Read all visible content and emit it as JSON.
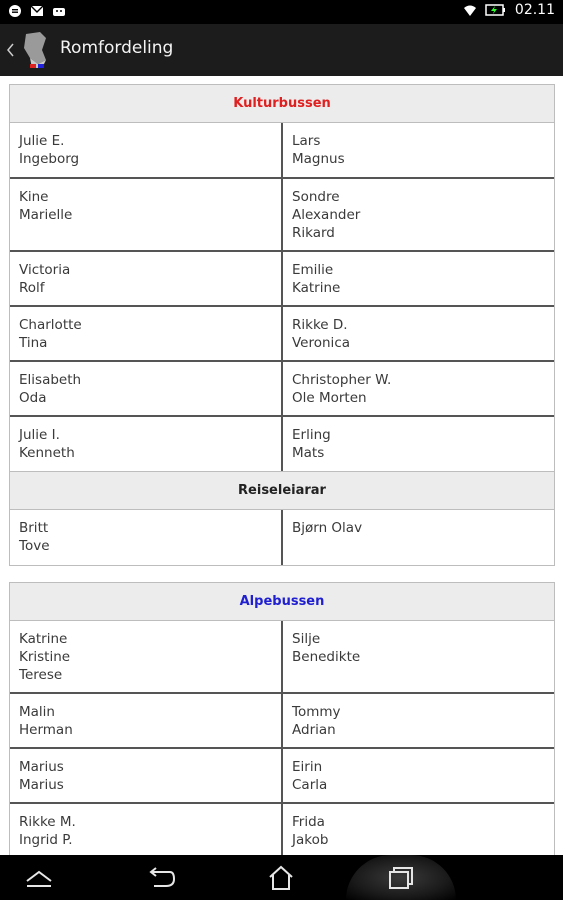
{
  "status_bar": {
    "time": "02.11",
    "icons": [
      "message-icon",
      "mail-icon",
      "android-icon",
      "wifi-icon",
      "battery-charging-icon"
    ]
  },
  "action_bar": {
    "title": "Romfordeling",
    "back_icon": "chevron-left-icon",
    "app_icon": "app-logo-icon"
  },
  "sections": [
    {
      "name": "Kulturbussen",
      "color": "#e02020",
      "rows": [
        [
          "Julie E.\nIngeborg",
          "Lars\nMagnus"
        ],
        [
          "Kine\nMarielle",
          "Sondre\nAlexander\nRikard"
        ],
        [
          "Victoria\nRolf",
          "Emilie\nKatrine"
        ],
        [
          "Charlotte\nTina",
          "Rikke D.\nVeronica"
        ],
        [
          "Elisabeth\nOda",
          "Christopher W.\nOle Morten"
        ],
        [
          "Julie I.\nKenneth",
          "Erling\nMats"
        ]
      ],
      "subheader": "Reiseleiarar",
      "sub_rows": [
        [
          "Britt\nTove",
          "Bjørn Olav"
        ]
      ]
    },
    {
      "name": "Alpebussen",
      "color": "#2020d0",
      "rows": [
        [
          "Katrine\nKristine\nTerese",
          "Silje\nBenedikte"
        ],
        [
          "Malin\nHerman",
          "Tommy\nAdrian"
        ],
        [
          "Marius\nMarius",
          "Eirin\nCarla"
        ],
        [
          "Rikke M.\nIngrid P.",
          "Frida\nJakob"
        ]
      ]
    }
  ],
  "nav_bar": {
    "icons": [
      "home-chevron-icon",
      "back-arrow-icon",
      "home-icon",
      "recent-apps-icon"
    ]
  }
}
